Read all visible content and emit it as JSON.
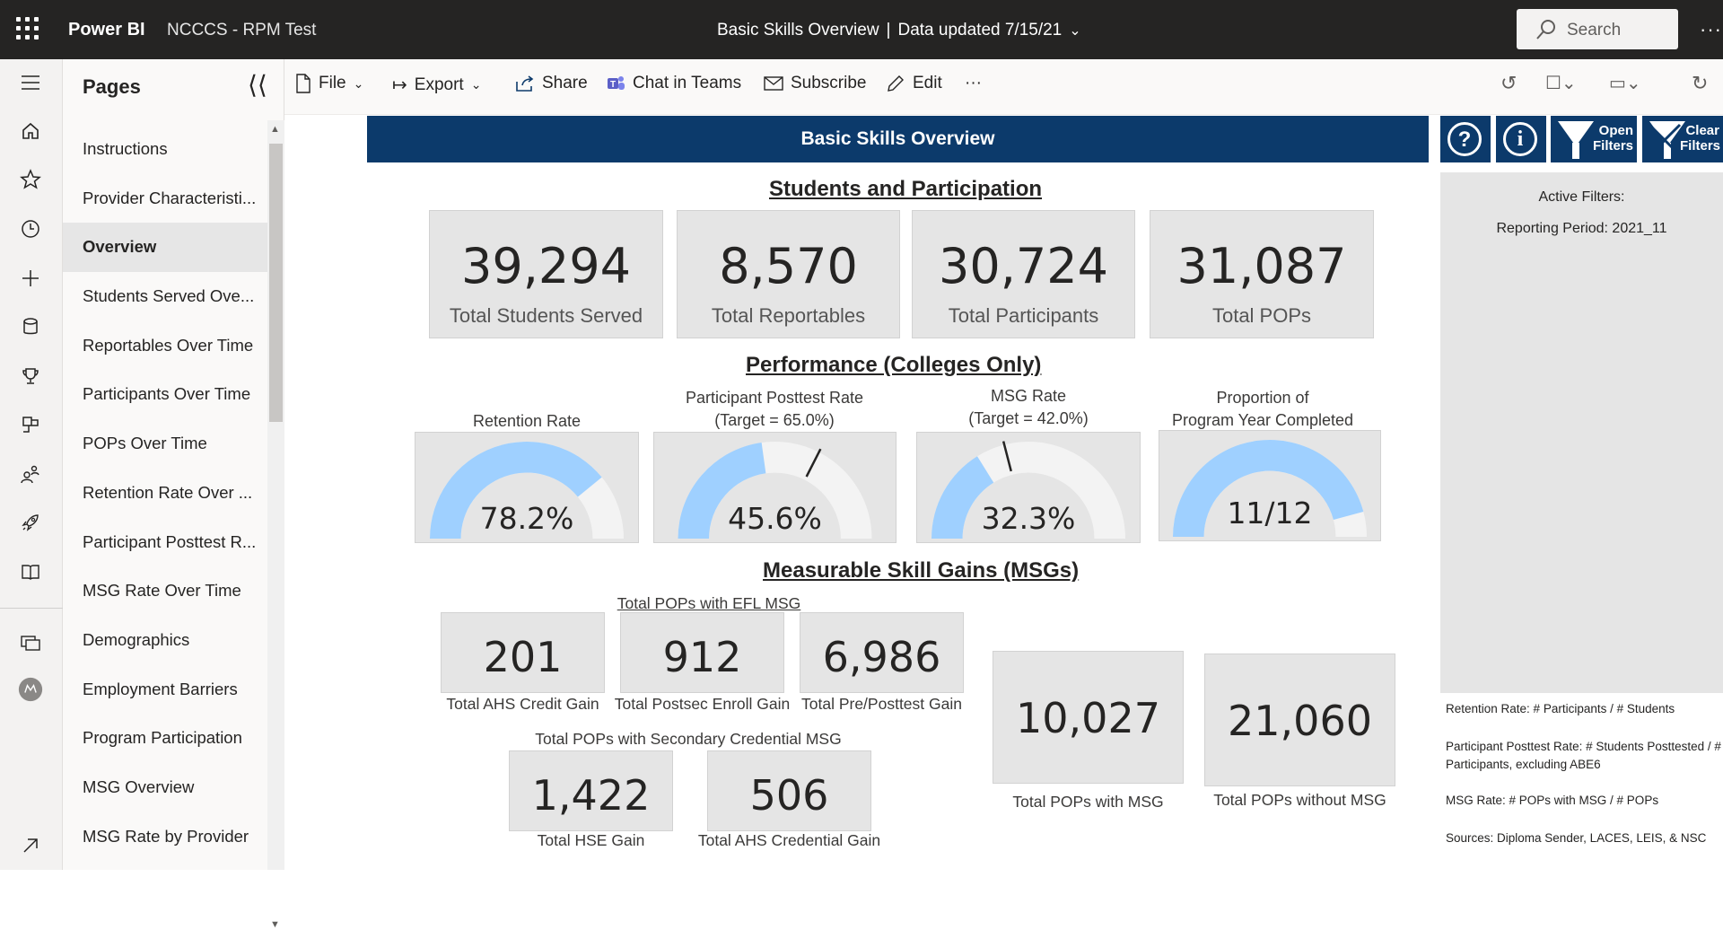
{
  "topbar": {
    "app_name": "Power BI",
    "workspace": "NCCCS - RPM Test",
    "report_title": "Basic Skills Overview",
    "separator": "|",
    "data_updated": "Data updated 7/15/21",
    "search_placeholder": "Search",
    "more": "···"
  },
  "rail_icons": [
    "menu-icon",
    "home-icon",
    "star-icon",
    "clock-icon",
    "plus-icon",
    "database-icon",
    "trophy-icon",
    "apps-icon",
    "people-icon",
    "rocket-icon",
    "book-icon",
    "monitor-icon",
    "avatar-icon",
    "expand-icon"
  ],
  "pages": {
    "header": "Pages",
    "items": [
      {
        "label": "Instructions"
      },
      {
        "label": "Provider Characteristi..."
      },
      {
        "label": "Overview",
        "active": true
      },
      {
        "label": "Students Served Ove..."
      },
      {
        "label": "Reportables Over Time"
      },
      {
        "label": "Participants Over Time"
      },
      {
        "label": "POPs Over Time"
      },
      {
        "label": "Retention Rate Over ..."
      },
      {
        "label": "Participant Posttest R..."
      },
      {
        "label": "MSG Rate Over Time"
      },
      {
        "label": "Demographics"
      },
      {
        "label": "Employment Barriers"
      },
      {
        "label": "Program Participation"
      },
      {
        "label": "MSG Overview"
      },
      {
        "label": "MSG Rate by Provider"
      }
    ]
  },
  "actionbar": {
    "file": "File",
    "export": "Export",
    "share": "Share",
    "chat": "Chat in Teams",
    "subscribe": "Subscribe",
    "edit": "Edit",
    "more": "···"
  },
  "report": {
    "banner": "Basic Skills Overview",
    "help_icon": "?",
    "info_icon": "i",
    "open_filters": "Open Filters",
    "clear_filters": "Clear Filters",
    "active_filters_label": "Active Filters:",
    "active_filters_value": "Reporting Period: 2021_11",
    "section1": "Students and Participation",
    "section2": "Performance (Colleges Only)",
    "section3": "Measurable Skill Gains (MSGs)",
    "kpis_top": [
      {
        "value": "39,294",
        "label": "Total Students Served"
      },
      {
        "value": "8,570",
        "label": "Total Reportables"
      },
      {
        "value": "30,724",
        "label": "Total Participants"
      },
      {
        "value": "31,087",
        "label": "Total POPs"
      }
    ],
    "gauges": [
      {
        "title": "Retention Rate",
        "value_text": "78.2%",
        "fraction": 0.782
      },
      {
        "title": "Participant Posttest Rate\n(Target = 65.0%)",
        "value_text": "45.6%",
        "fraction": 0.456,
        "target": 0.65
      },
      {
        "title": "MSG Rate\n(Target = 42.0%)",
        "value_text": "32.3%",
        "fraction": 0.323,
        "target": 0.42
      },
      {
        "title": "Proportion of\nProgram Year Completed",
        "value_text": "11/12",
        "fraction": 0.9167
      }
    ],
    "efl_group_label": "Total POPs with EFL MSG",
    "efl_kpis": [
      {
        "value": "201",
        "label": "Total AHS Credit Gain"
      },
      {
        "value": "912",
        "label": "Total Postsec Enroll Gain"
      },
      {
        "value": "6,986",
        "label": "Total Pre/Posttest Gain"
      }
    ],
    "secondary_group_label": "Total POPs with Secondary Credential MSG",
    "secondary_kpis": [
      {
        "value": "1,422",
        "label": "Total HSE Gain"
      },
      {
        "value": "506",
        "label": "Total AHS Credential Gain"
      }
    ],
    "msg_kpis": [
      {
        "value": "10,027",
        "label": "Total POPs with MSG"
      },
      {
        "value": "21,060",
        "label": "Total POPs without MSG"
      }
    ],
    "notes": [
      "Retention Rate: # Participants / # Students",
      "Participant Posttest Rate: # Students Posttested / # Participants, excluding ABE6",
      "MSG Rate: # POPs with MSG / # POPs",
      "Sources: Diploma Sender, LACES, LEIS, & NSC"
    ]
  },
  "colors": {
    "topbar": "#252423",
    "banner": "#0c3a6b",
    "gauge_fill": "#9fd0ff",
    "gauge_track": "#f3f3f3",
    "card": "#e5e5e5"
  }
}
